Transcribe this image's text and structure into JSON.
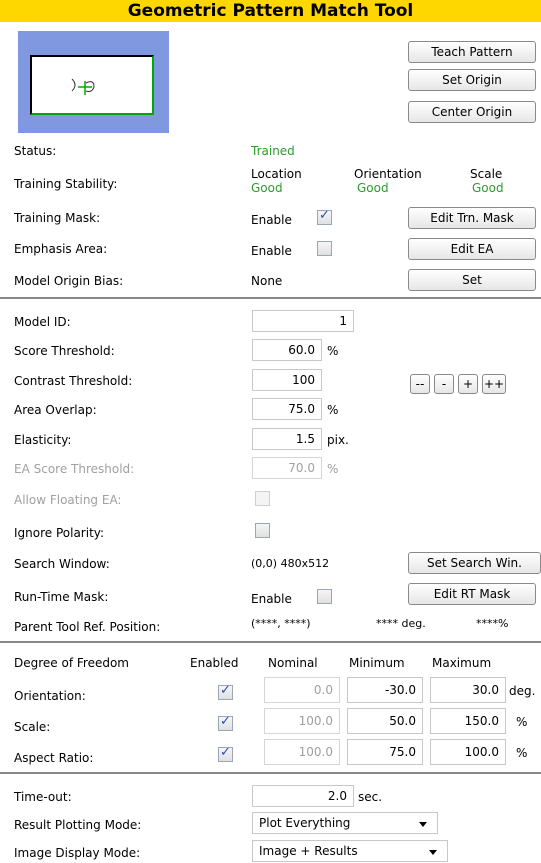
{
  "title": "Geometric Pattern Match Tool",
  "buttons": {
    "teach_pattern": "Teach Pattern",
    "set_origin": "Set Origin",
    "center_origin": "Center Origin",
    "edit_trn_mask": "Edit Trn. Mask",
    "edit_ea": "Edit EA",
    "set": "Set",
    "dec_dec": "--",
    "dec": "-",
    "inc": "+",
    "inc_inc": "++",
    "set_search_win": "Set Search Win.",
    "edit_rt_mask": "Edit RT Mask"
  },
  "training": {
    "status_label": "Status:",
    "status_value": "Trained",
    "stability_label": "Training Stability:",
    "location_label": "Location",
    "location_value": "Good",
    "orientation_label": "Orientation",
    "orientation_value": "Good",
    "scale_label": "Scale",
    "scale_value": "Good",
    "mask_label": "Training Mask:",
    "mask_enable_label": "Enable",
    "mask_enabled": true,
    "emphasis_label": "Emphasis Area:",
    "emphasis_enable_label": "Enable",
    "emphasis_enabled": false,
    "origin_bias_label": "Model Origin Bias:",
    "origin_bias_value": "None"
  },
  "params": {
    "model_id_label": "Model ID:",
    "model_id": "1",
    "score_label": "Score Threshold:",
    "score": "60.0",
    "score_unit": "%",
    "contrast_label": "Contrast Threshold:",
    "contrast": "100",
    "overlap_label": "Area Overlap:",
    "overlap": "75.0",
    "overlap_unit": "%",
    "elasticity_label": "Elasticity:",
    "elasticity": "1.5",
    "elasticity_unit": "pix.",
    "ea_score_label": "EA Score Threshold:",
    "ea_score": "70.0",
    "ea_score_unit": "%",
    "floating_label": "Allow Floating EA:",
    "polarity_label": "Ignore Polarity:",
    "search_label": "Search Window:",
    "search_value": "(0,0) 480x512",
    "rt_mask_label": "Run-Time Mask:",
    "rt_mask_enable_label": "Enable",
    "parent_label": "Parent Tool Ref. Position:",
    "parent_pos": "(****, ****)",
    "parent_deg": "**** deg.",
    "parent_pct": "****%"
  },
  "dof": {
    "header": "Degree of Freedom",
    "col_enabled": "Enabled",
    "col_nominal": "Nominal",
    "col_minimum": "Minimum",
    "col_maximum": "Maximum",
    "rows": [
      {
        "label": "Orientation:",
        "nominal": "0.0",
        "minimum": "-30.0",
        "maximum": "30.0",
        "unit": "deg."
      },
      {
        "label": "Scale:",
        "nominal": "100.0",
        "minimum": "50.0",
        "maximum": "150.0",
        "unit": "%"
      },
      {
        "label": "Aspect Ratio:",
        "nominal": "100.0",
        "minimum": "75.0",
        "maximum": "100.0",
        "unit": "%"
      }
    ]
  },
  "bottom": {
    "timeout_label": "Time-out:",
    "timeout": "2.0",
    "timeout_unit": "sec.",
    "plotting_label": "Result Plotting Mode:",
    "plotting_value": "Plot Everything",
    "display_label": "Image Display Mode:",
    "display_value": "Image + Results"
  },
  "colors": {
    "title_bg": "#ffd700",
    "accent_green": "#2e9b2e",
    "preview_bg": "#7f98e0"
  }
}
